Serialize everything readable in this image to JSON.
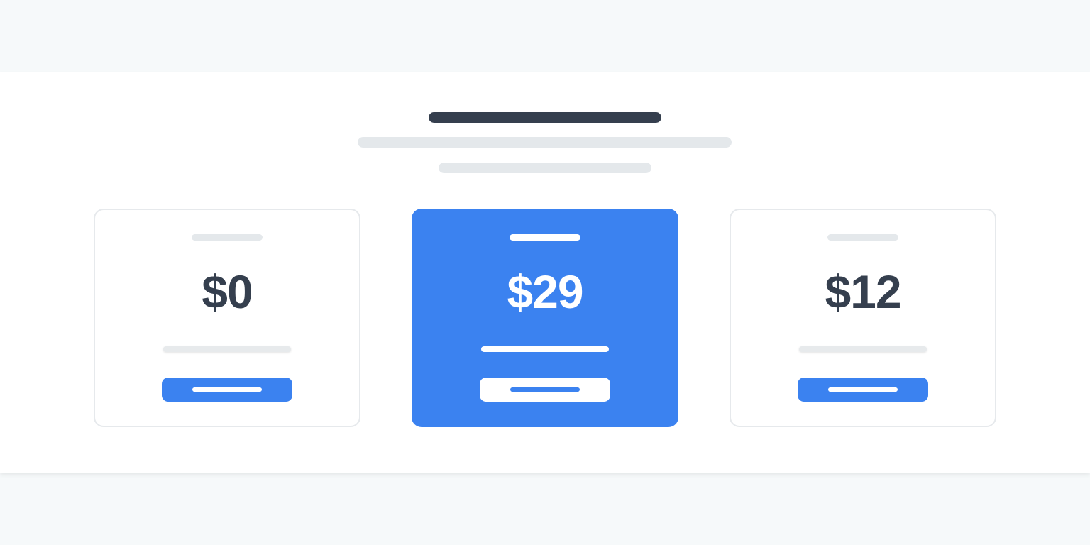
{
  "colors": {
    "page_background": "#f6f9fa",
    "section_background": "#ffffff",
    "title_bar": "#353f4e",
    "subtitle_bar": "#e4e8eb",
    "accent": "#3b82f0",
    "card_border": "#e6e9ec",
    "price_text_dark": "#353f4e",
    "price_text_light": "#ffffff"
  },
  "pricing": {
    "plans": [
      {
        "price": "$0",
        "featured": false
      },
      {
        "price": "$29",
        "featured": true
      },
      {
        "price": "$12",
        "featured": false
      }
    ]
  }
}
